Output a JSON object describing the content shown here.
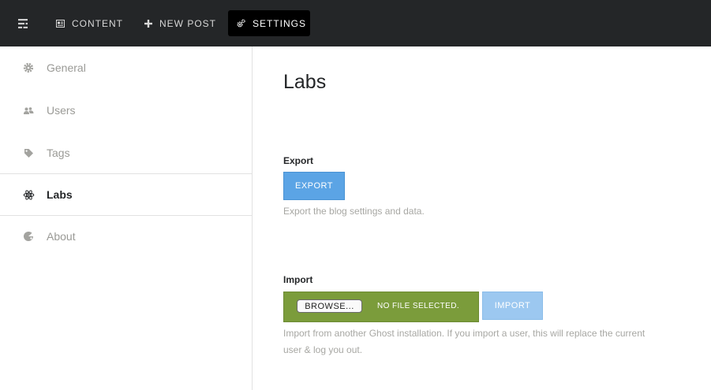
{
  "topbar": {
    "menu_icon": "menu-icon",
    "nav": [
      {
        "label": "CONTENT",
        "icon": "content-icon"
      },
      {
        "label": "NEW POST",
        "icon": "plus-icon"
      },
      {
        "label": "SETTINGS",
        "icon": "gears-icon",
        "active": true
      }
    ]
  },
  "sidebar": {
    "items": [
      {
        "label": "General",
        "icon": "gear-icon"
      },
      {
        "label": "Users",
        "icon": "users-icon"
      },
      {
        "label": "Tags",
        "icon": "tag-icon"
      },
      {
        "label": "Labs",
        "icon": "atom-icon",
        "active": true
      },
      {
        "label": "About",
        "icon": "ghost-icon"
      }
    ]
  },
  "main": {
    "title": "Labs",
    "export": {
      "label": "Export",
      "button": "EXPORT",
      "help": "Export the blog settings and data."
    },
    "import": {
      "label": "Import",
      "browse_button": "BROWSE...",
      "file_status": "NO FILE SELECTED.",
      "button": "IMPORT",
      "help_line1": "Import from another Ghost installation. If you import a user, this will replace the current",
      "help_line2": "user & log you out."
    }
  },
  "colors": {
    "topbar_bg": "#242628",
    "export_button": "#5ba4e5",
    "import_box": "#7b9c3b",
    "import_button_disabled": "#9cc8f0"
  }
}
